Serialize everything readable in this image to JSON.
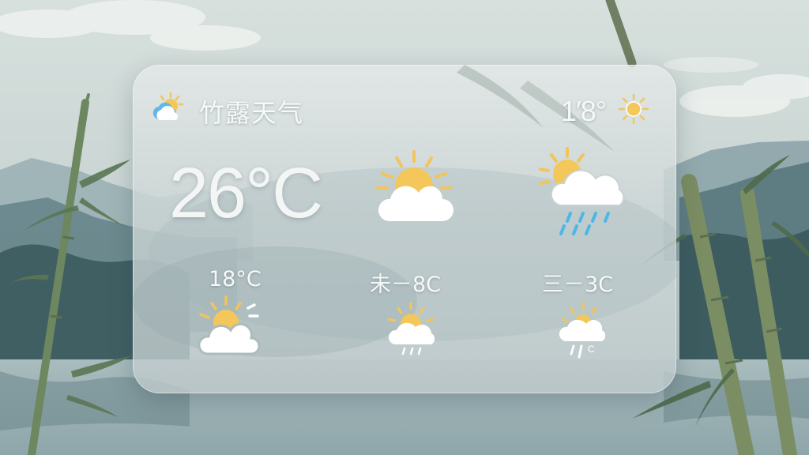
{
  "widget": {
    "title": "竹露天气",
    "header_icon": "partly-cloudy-icon",
    "corner_temp": "1′8°",
    "corner_icon": "sun-icon",
    "current_temp": "26°C",
    "current_icon": "sun-behind-cloud-icon",
    "secondary_icon": "sun-cloud-rain-icon"
  },
  "forecast": [
    {
      "label": "18°C",
      "icon": "sun-behind-cloud-icon"
    },
    {
      "label": "未－8C",
      "icon": "sun-cloud-rain-icon"
    },
    {
      "label": "三－3C",
      "icon": "cloud-rain-icon"
    }
  ],
  "fc3_icon_text": "C",
  "colors": {
    "sun": "#F3C75A",
    "sun_ray": "#F1C55C",
    "cloud": "#FFFFFF",
    "rain": "#4BB8E6",
    "text": "#F7F8F8"
  }
}
